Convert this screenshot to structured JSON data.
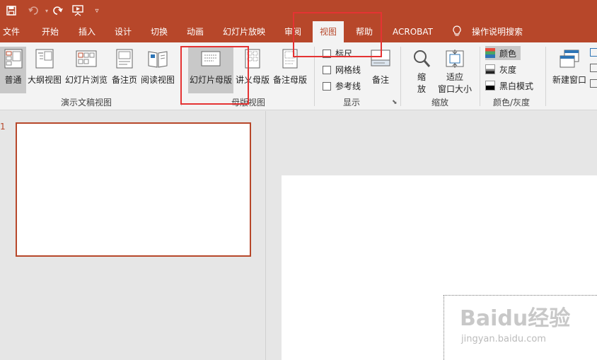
{
  "tabs": {
    "file": "文件",
    "home": "开始",
    "insert": "插入",
    "design": "设计",
    "transitions": "切换",
    "animations": "动画",
    "slideshow": "幻灯片放映",
    "review": "审阅",
    "view": "视图",
    "help": "帮助",
    "acrobat": "ACROBAT",
    "search": "操作说明搜索"
  },
  "ribbon": {
    "normal": "普通",
    "outline": "大纲视图",
    "sorter": "幻灯片浏览",
    "notes_page": "备注页",
    "reading": "阅读视图",
    "group_presentation_views": "演示文稿视图",
    "slide_master": "幻灯片母版",
    "handout_master": "讲义母版",
    "notes_master": "备注母版",
    "group_master_views": "母版视图",
    "ruler": "标尺",
    "gridlines": "网格线",
    "guides": "参考线",
    "notes": "备注",
    "group_show": "显示",
    "zoom": "缩放",
    "zoom_btn_line1": "缩",
    "zoom_btn_line2": "放",
    "fit_line1": "适应",
    "fit_line2": "窗口大小",
    "group_zoom": "缩放",
    "color": "颜色",
    "grayscale": "灰度",
    "bw": "黑白模式",
    "group_color": "颜色/灰度",
    "new_window": "新建窗口"
  },
  "slides": {
    "number": "1"
  },
  "watermark": {
    "logo": "Baidu经验",
    "url": "jingyan.baidu.com"
  },
  "colors": {
    "accent": "#b7472a",
    "highlight_box": "#e53333"
  }
}
